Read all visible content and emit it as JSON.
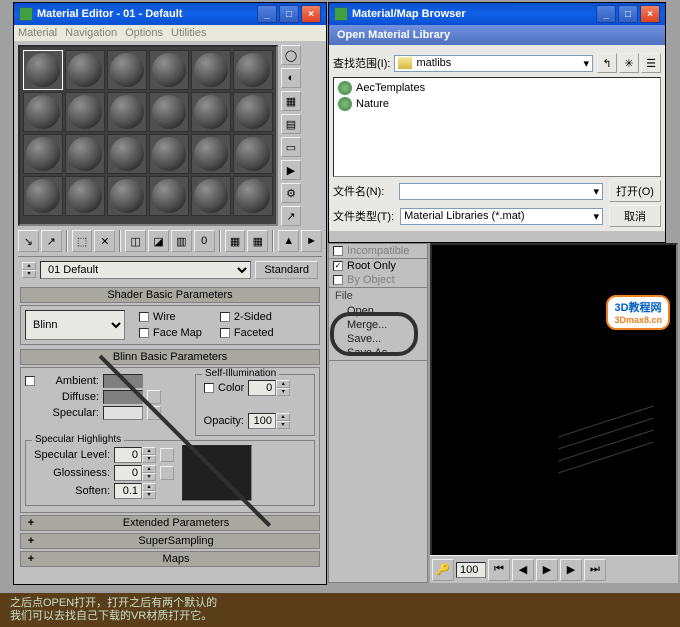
{
  "mat_editor": {
    "title": "Material Editor - 01 - Default",
    "menu": [
      "Material",
      "Navigation",
      "Options",
      "Utilities"
    ],
    "name_selector": "01 Default",
    "standard_btn": "Standard",
    "rollout1": "Shader Basic Parameters",
    "shader": "Blinn",
    "opts": {
      "wire": "Wire",
      "twosided": "2-Sided",
      "facemap": "Face Map",
      "faceted": "Faceted"
    },
    "rollout2": "Blinn Basic Parameters",
    "labels": {
      "ambient": "Ambient:",
      "diffuse": "Diffuse:",
      "specular": "Specular:",
      "selfillum": "Self-Illumination",
      "color": "Color",
      "color_val": "0",
      "opacity": "Opacity:",
      "opacity_val": "100"
    },
    "spec": {
      "title": "Specular Highlights",
      "level": "Specular Level:",
      "level_val": "0",
      "gloss": "Glossiness:",
      "gloss_val": "0",
      "soften": "Soften:",
      "soften_val": "0.1"
    },
    "roll_ext": "Extended Parameters",
    "roll_ss": "SuperSampling",
    "roll_maps": "Maps"
  },
  "browser": {
    "title": "Material/Map Browser",
    "dialog": "Open Material Library",
    "lookin_label": "查找范围(I):",
    "folder": "matlibs",
    "files": [
      "AecTemplates",
      "Nature"
    ],
    "filename_label": "文件名(N):",
    "filetype_label": "文件类型(T):",
    "filetype_val": "Material Libraries (*.mat)",
    "open_btn": "打开(O)",
    "cancel_btn": "取消"
  },
  "side_panel": {
    "incomp": "Incompatible",
    "root": "Root Only",
    "byobj": "By Object",
    "file": "File",
    "open": "Open...",
    "merge": "Merge...",
    "save": "Save...",
    "saveas": "Save As..."
  },
  "footer": {
    "val": "100"
  },
  "watermark": {
    "top": "3D教程网",
    "bot": "3Dmax8.cn"
  },
  "caption": {
    "line1": "之后点OPEN打开，打开之后有两个默认的",
    "line2": "我们可以去找自己下载的VR材质打开它。"
  }
}
